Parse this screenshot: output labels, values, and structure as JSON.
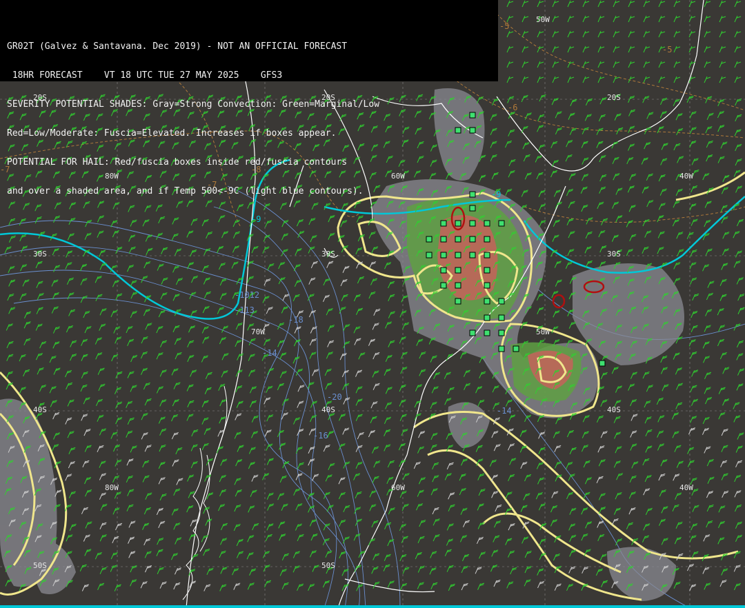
{
  "header": {
    "line1": "GR02T (Galvez & Santavana. Dec 2019) - NOT AN OFFICIAL FORECAST",
    "line2": " 18HR FORECAST    VT 18 UTC TUE 27 MAY 2025    GFS3",
    "line3": "SEVERITY POTENTIAL SHADES: Gray=Strong Convection: Green=Marginal/Low",
    "line4": "Red=Low/Moderate: Fuscia=Elevated. Increases if boxes appear.",
    "line5": "POTENTIAL FOR HAIL: Red/fuscia boxes inside red/fuscia contours",
    "line6": "and over a shaded area, and if Temp 500<-9C (light blue contours)."
  },
  "grid_labels": {
    "lat_20s_a": "20S",
    "lat_20s_b": "20S",
    "lat_20s_c": "20S",
    "lat_30s_a": "30S",
    "lat_30s_b": "30S",
    "lat_30s_c": "30S",
    "lat_40s_a": "40S",
    "lat_40s_b": "40S",
    "lat_40s_c": "40S",
    "lat_50s_a": "50S",
    "lat_50s_b": "50S",
    "lon_80w_a": "80W",
    "lon_80w_b": "80W",
    "lon_70w": "70W",
    "lon_60w_a": "60W",
    "lon_60w_b": "60W",
    "lon_50w_a": "50W",
    "lon_50w_b": "50W",
    "lon_40w_a": "40W",
    "lon_40w_b": "40W"
  },
  "contour_labels": {
    "t_m5_a": "-5",
    "t_m5_b": "-5",
    "t_m6": "-6",
    "t_m7_a": "-7",
    "t_m7_b": "-7",
    "t_m8": "-8",
    "t_m9_a": "-9",
    "t_m9_b": "-9",
    "t_m10": "-1012",
    "t_m13": "-113",
    "t_m18": "-18",
    "t_m14_a": "-14",
    "t_m14_b": "-14",
    "t_m20": "-20",
    "t_m16": "-16"
  },
  "colors": {
    "background": "#3a3835",
    "coastline": "#ffffff",
    "temp_500_contour": "#00c8d8",
    "severity_yellow": "#f0e68c",
    "shade_gray": "#8a8a92",
    "shade_green": "#5fa043",
    "shade_red": "#c0655a",
    "hail_box": "#3fe070",
    "hail_contour": "#b01010",
    "wind_green": "#30d030",
    "wind_white": "#d0d0d0",
    "isotherm_brown": "#b07a3a",
    "isobar_blue": "#6a8fd0"
  }
}
